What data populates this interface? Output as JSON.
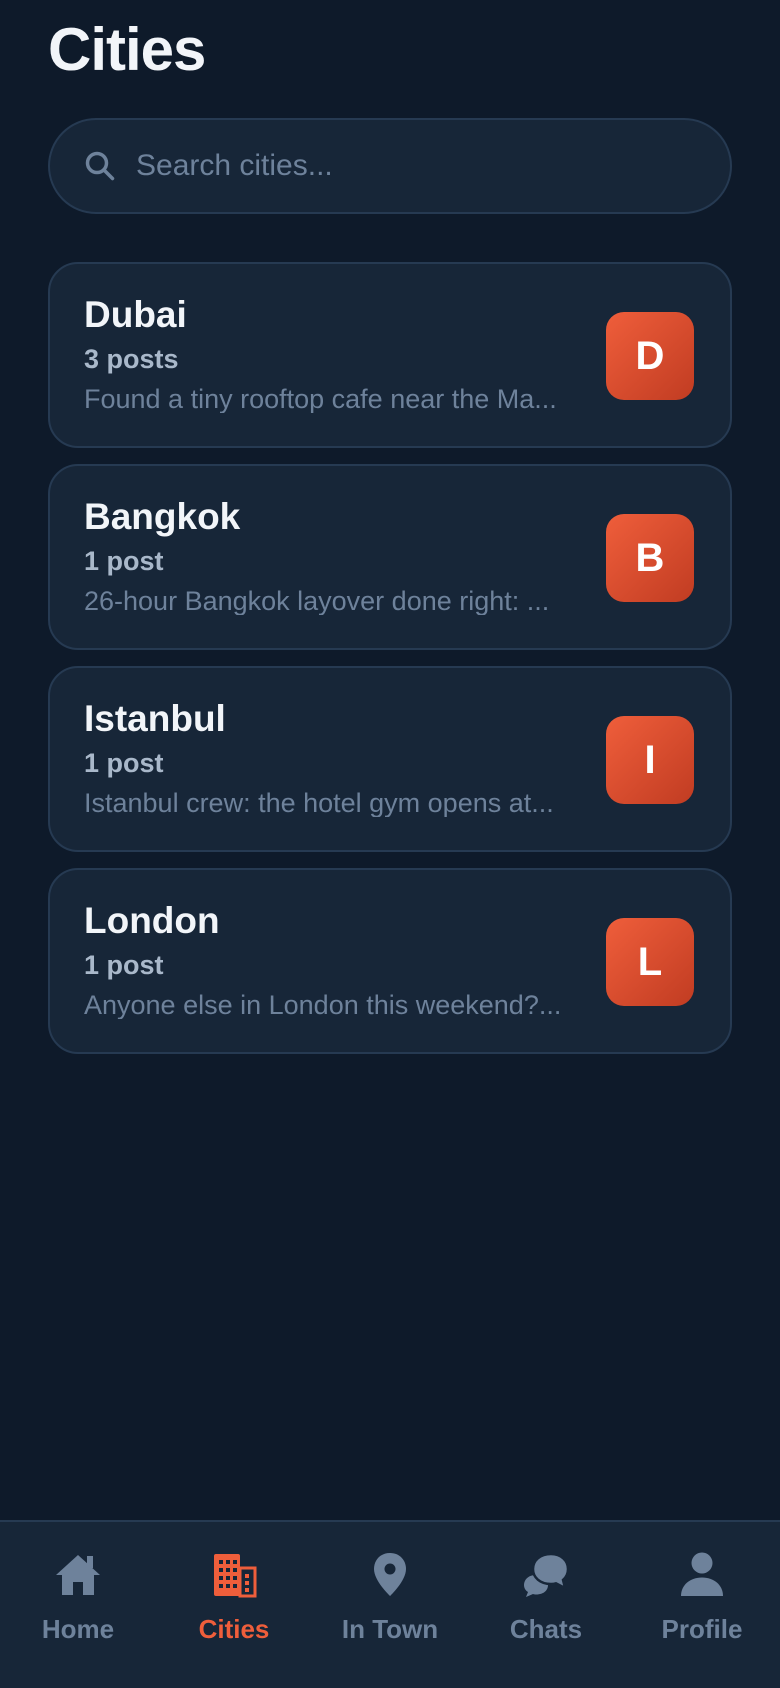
{
  "page": {
    "title": "Cities"
  },
  "search": {
    "placeholder": "Search cities...",
    "value": ""
  },
  "cities": [
    {
      "name": "Dubai",
      "count": "3 posts",
      "preview": "Found a tiny rooftop cafe near the Ma...",
      "initial": "D"
    },
    {
      "name": "Bangkok",
      "count": "1 post",
      "preview": "26-hour Bangkok layover done right: ...",
      "initial": "B"
    },
    {
      "name": "Istanbul",
      "count": "1 post",
      "preview": "Istanbul crew: the hotel gym opens at...",
      "initial": "I"
    },
    {
      "name": "London",
      "count": "1 post",
      "preview": "Anyone else in London this weekend?...",
      "initial": "L"
    }
  ],
  "nav": {
    "items": [
      {
        "label": "Home",
        "icon": "home-icon",
        "active": false
      },
      {
        "label": "Cities",
        "icon": "city-icon",
        "active": true
      },
      {
        "label": "In Town",
        "icon": "map-pin-icon",
        "active": false
      },
      {
        "label": "Chats",
        "icon": "chat-icon",
        "active": false
      },
      {
        "label": "Profile",
        "icon": "person-icon",
        "active": false
      }
    ]
  },
  "colors": {
    "background": "#0e1a2a",
    "card": "#172638",
    "accent": "#ef5e3b",
    "muted": "#6e829b"
  }
}
